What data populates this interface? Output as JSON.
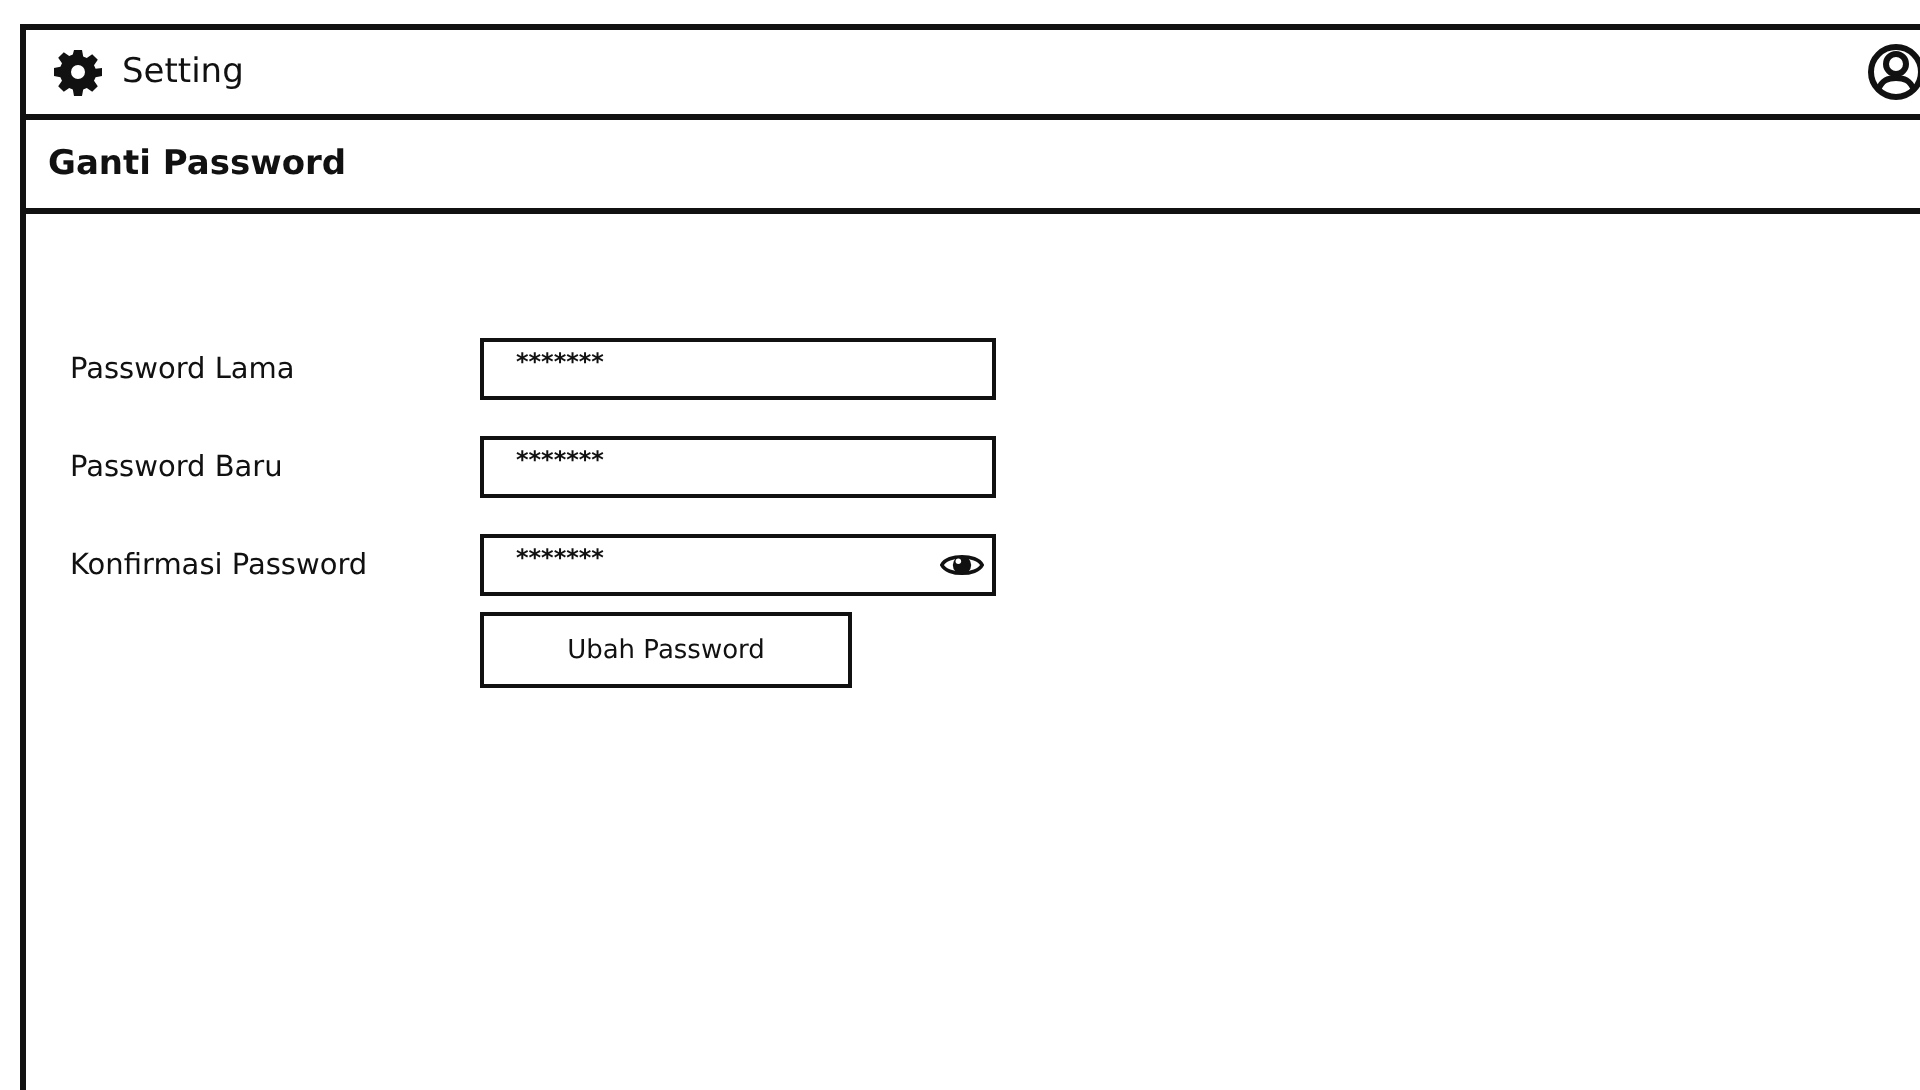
{
  "header": {
    "title": "Setting"
  },
  "section": {
    "title": "Ganti Password"
  },
  "fields": [
    {
      "kind": "plain",
      "label": "Password Lama",
      "value": "*******"
    },
    {
      "kind": "plain",
      "label": "Password Baru",
      "value": "*******"
    },
    {
      "kind": "reveal",
      "label": "Konfirmasi Password",
      "value": "*******"
    }
  ],
  "button": {
    "label": "Ubah Password"
  }
}
